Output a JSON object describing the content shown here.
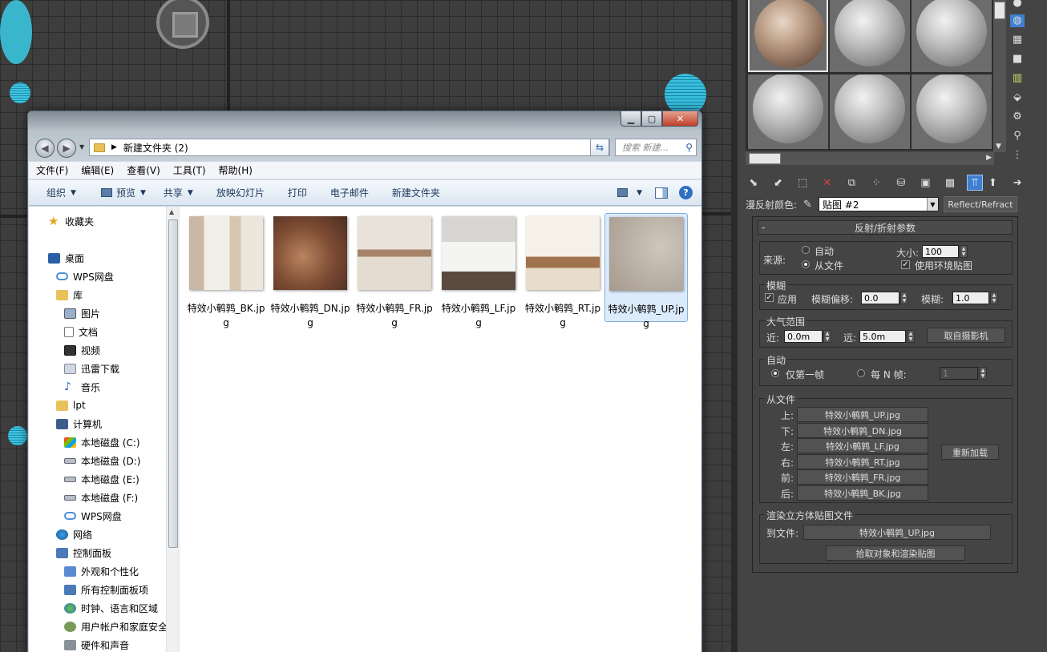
{
  "explorer": {
    "address": "新建文件夹 (2)",
    "search_placeholder": "搜索 新建...",
    "menu": [
      "文件(F)",
      "编辑(E)",
      "查看(V)",
      "工具(T)",
      "帮助(H)"
    ],
    "toolbar": {
      "organize": "组织",
      "preview": "预览",
      "share": "共享",
      "slideshow": "放映幻灯片",
      "print": "打印",
      "email": "电子邮件",
      "new_folder": "新建文件夹"
    },
    "nav": {
      "favorites": "收藏夹",
      "desktop": "桌面",
      "wps1": "WPS网盘",
      "library": "库",
      "pictures": "图片",
      "documents": "文档",
      "videos": "视频",
      "xunlei": "迅雷下载",
      "music": "音乐",
      "lpt": "lpt",
      "computer": "计算机",
      "disk_c": "本地磁盘 (C:)",
      "disk_d": "本地磁盘 (D:)",
      "disk_e": "本地磁盘 (E:)",
      "disk_f": "本地磁盘 (F:)",
      "wps2": "WPS网盘",
      "network": "网络",
      "control_panel": "控制面板",
      "appearance": "外观和个性化",
      "all_items": "所有控制面板项",
      "clock": "时钟、语言和区域",
      "accounts": "用户帐户和家庭安全",
      "hardware": "硬件和声音"
    },
    "files": [
      {
        "name": "特效小鹌鹑_BK.jpg"
      },
      {
        "name": "特效小鹌鹑_DN.jpg"
      },
      {
        "name": "特效小鹌鹑_FR.jpg"
      },
      {
        "name": "特效小鹌鹑_LF.jpg"
      },
      {
        "name": "特效小鹌鹑_RT.jpg"
      },
      {
        "name": "特效小鹌鹑_UP.jpg"
      }
    ]
  },
  "max": {
    "diffuse_label": "漫反射颜色:",
    "map_name": "贴图 #2",
    "map_type": "Reflect/Refract",
    "rollout_title": "反射/折射参数",
    "source": {
      "label": "来源:",
      "auto": "自动",
      "from_file": "从文件",
      "size_label": "大小:",
      "size_value": "100",
      "use_env": "使用环境贴图"
    },
    "blur": {
      "title": "模糊",
      "apply": "应用",
      "offset_label": "模糊偏移:",
      "offset_value": "0.0",
      "blur_label": "模糊:",
      "blur_value": "1.0"
    },
    "atmosphere": {
      "title": "大气范围",
      "near_label": "近:",
      "near_value": "0.0m",
      "far_label": "远:",
      "far_value": "5.0m",
      "camera_button": "取自摄影机"
    },
    "auto_group": {
      "title": "自动",
      "first_frame": "仅第一帧",
      "every_n": "每 N 帧:",
      "n_value": "1"
    },
    "from_file": {
      "title": "从文件",
      "up_label": "上:",
      "up_file": "特效小鹌鹑_UP.jpg",
      "dn_label": "下:",
      "dn_file": "特效小鹌鹑_DN.jpg",
      "lf_label": "左:",
      "lf_file": "特效小鹌鹑_LF.jpg",
      "rt_label": "右:",
      "rt_file": "特效小鹌鹑_RT.jpg",
      "fr_label": "前:",
      "fr_file": "特效小鹌鹑_FR.jpg",
      "bk_label": "后:",
      "bk_file": "特效小鹌鹑_BK.jpg",
      "reload": "重新加载"
    },
    "render_cube": {
      "title": "渲染立方体贴图文件",
      "to_file_label": "到文件:",
      "to_file": "特效小鹌鹑_UP.jpg",
      "pick_button": "拾取对象和渲染贴图"
    }
  }
}
